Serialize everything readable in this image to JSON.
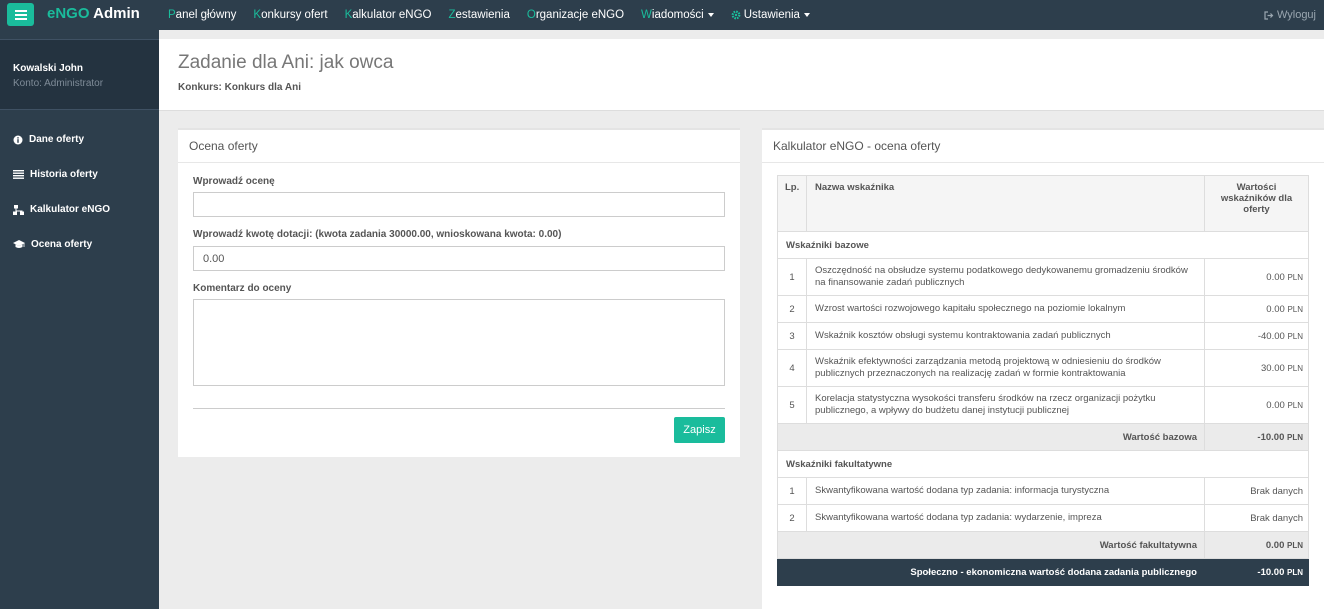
{
  "app": {
    "brand_prefix": "e",
    "brand_accent": "NGO",
    "brand_suffix": " Admin",
    "accent_color": "#1abc9c",
    "nav_bg_color": "#2d3e4c"
  },
  "nav": {
    "items": [
      {
        "first": "P",
        "rest": "anel główny",
        "dropdown": false
      },
      {
        "first": "K",
        "rest": "onkursy ofert",
        "dropdown": false
      },
      {
        "first": "K",
        "rest": "alkulator eNGO",
        "dropdown": false
      },
      {
        "first": "Z",
        "rest": "estawienia",
        "dropdown": false
      },
      {
        "first": "O",
        "rest": "rganizacje eNGO",
        "dropdown": false
      },
      {
        "first": "W",
        "rest": "iadomości",
        "dropdown": true
      }
    ],
    "settings_label": "Ustawienia",
    "logout_label": "Wyloguj"
  },
  "sidebar": {
    "user_name": "Kowalski John",
    "user_role": "Konto: Administrator",
    "items": [
      {
        "label": "Dane oferty",
        "icon": "info-icon"
      },
      {
        "label": "Historia oferty",
        "icon": "list-icon"
      },
      {
        "label": "Kalkulator eNGO",
        "icon": "sitemap-icon"
      },
      {
        "label": "Ocena oferty",
        "icon": "graduation-cap-icon"
      }
    ]
  },
  "header": {
    "title": "Zadanie dla Ani: jak owca",
    "subtitle": "Konkurs: Konkurs dla Ani"
  },
  "form": {
    "title": "Ocena oferty",
    "score_label": "Wprowadź ocenę",
    "score_value": "",
    "amount_label": "Wprowadź kwotę dotacji: (kwota zadania 30000.00, wnioskowana kwota: 0.00)",
    "amount_value": "0.00",
    "comment_label": "Komentarz do oceny",
    "comment_value": "",
    "save_label": "Zapisz"
  },
  "calculator": {
    "title": "Kalkulator eNGO - ocena oferty",
    "col_lp": "Lp.",
    "col_name": "Nazwa wskaźnika",
    "col_value": "Wartości wskaźników dla oferty",
    "unit": "PLN",
    "base_section": "Wskaźniki bazowe",
    "base_rows": [
      {
        "lp": "1",
        "name": "Oszczędność na obsłudze systemu podatkowego dedykowanemu gromadzeniu środków na finansowanie zadań publicznych",
        "value": "0.00"
      },
      {
        "lp": "2",
        "name": "Wzrost wartości rozwojowego kapitału społecznego na poziomie lokalnym",
        "value": "0.00"
      },
      {
        "lp": "3",
        "name": "Wskaźnik kosztów obsługi systemu kontraktowania zadań publicznych",
        "value": "-40.00"
      },
      {
        "lp": "4",
        "name": "Wskaźnik efektywności zarządzania metodą projektową w odniesieniu do środków publicznych przeznaczonych na realizację zadań w formie kontraktowania",
        "value": "30.00"
      },
      {
        "lp": "5",
        "name": "Korelacja statystyczna wysokości transferu środków na rzecz organizacji pożytku publicznego, a wpływy do budżetu danej instytucji publicznej",
        "value": "0.00"
      }
    ],
    "base_sum_label": "Wartość bazowa",
    "base_sum_value": "-10.00",
    "optional_section": "Wskaźniki fakultatywne",
    "optional_rows": [
      {
        "lp": "1",
        "name": "Skwantyfikowana wartość dodana typ zadania: informacja turystyczna",
        "value": "Brak danych"
      },
      {
        "lp": "2",
        "name": "Skwantyfikowana wartość dodana typ zadania: wydarzenie, impreza",
        "value": "Brak danych"
      }
    ],
    "optional_sum_label": "Wartość fakultatywna",
    "optional_sum_value": "0.00",
    "total_label": "Społeczno - ekonomiczna wartość dodana zadania publicznego",
    "total_value": "-10.00",
    "no_data_color": "#c0392b"
  }
}
